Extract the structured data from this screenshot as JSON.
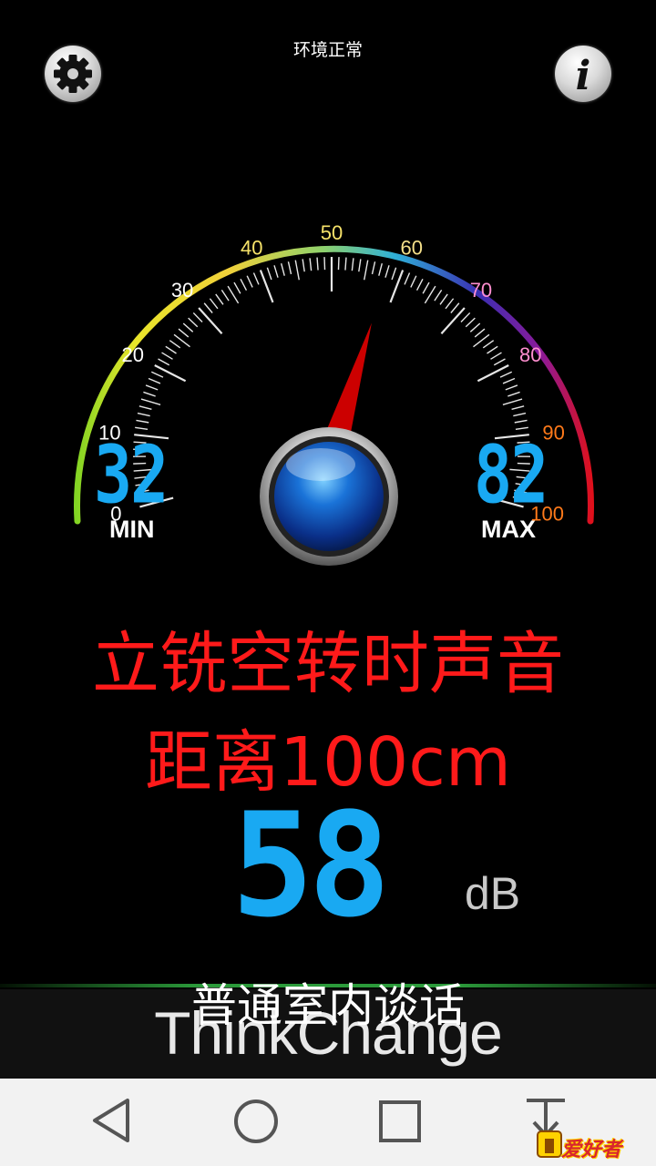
{
  "status": {
    "text": "环境正常"
  },
  "toolbar": {
    "settings_icon": "gear-icon",
    "info_icon": "info-icon",
    "info_glyph": "i"
  },
  "gauge": {
    "scale_min": 0,
    "scale_max": 100,
    "tick_labels": [
      "0",
      "10",
      "20",
      "30",
      "40",
      "50",
      "60",
      "70",
      "80",
      "90",
      "100"
    ],
    "needle_value": 58,
    "min_value": "32",
    "max_value": "82",
    "min_label": "MIN",
    "max_label": "MAX"
  },
  "caption": {
    "line1": "立铣空转时声音",
    "line2": "距离100cm"
  },
  "reading": {
    "value": "58",
    "unit": "dB",
    "description": "普通室内谈话"
  },
  "brand": {
    "text": "ThinkChange"
  },
  "navbar": {
    "back_icon": "back-triangle-icon",
    "home_icon": "home-circle-icon",
    "recents_icon": "recents-square-icon",
    "extra_icon": "download-icon"
  },
  "watermark": {
    "text": "爱好者"
  },
  "colors": {
    "digital": "#19a9f2",
    "caption": "#ff1a1a",
    "needle": "#cc0000"
  }
}
